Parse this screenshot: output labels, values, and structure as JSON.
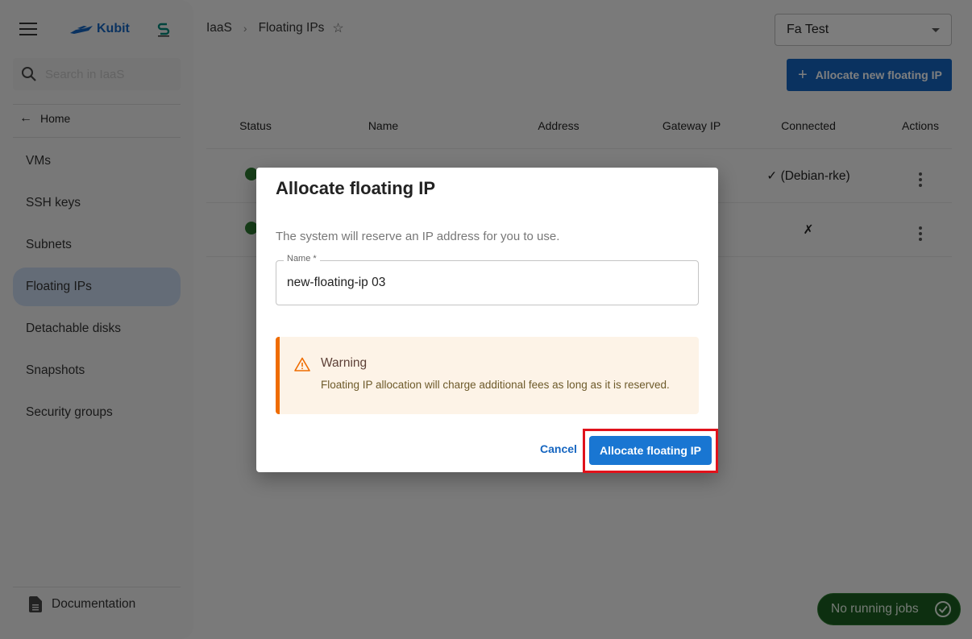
{
  "sidebar": {
    "logo_text": "Kubit",
    "search_placeholder": "Search in IaaS",
    "home_label": "Home",
    "items": [
      {
        "label": "VMs"
      },
      {
        "label": "SSH keys"
      },
      {
        "label": "Subnets"
      },
      {
        "label": "Floating IPs",
        "active": true
      },
      {
        "label": "Detachable disks"
      },
      {
        "label": "Snapshots"
      },
      {
        "label": "Security groups"
      }
    ],
    "documentation_label": "Documentation"
  },
  "header": {
    "breadcrumb": [
      "IaaS",
      "Floating IPs"
    ],
    "project_select": "Fa Test",
    "allocate_new_label": "Allocate new floating IP"
  },
  "table": {
    "columns": [
      "Status",
      "Name",
      "Address",
      "Gateway IP",
      "Connected",
      "Actions"
    ],
    "rows": [
      {
        "status": "active",
        "connected": "✓ (Debian-rke)"
      },
      {
        "status": "active",
        "connected": "✗"
      }
    ]
  },
  "dialog": {
    "title": "Allocate floating IP",
    "description": "The system will reserve an IP address for you to use.",
    "name_label": "Name *",
    "name_value": "new-floating-ip 03",
    "warning_title": "Warning",
    "warning_body": "Floating IP allocation will charge additional fees as long as it is reserved.",
    "cancel_label": "Cancel",
    "confirm_label": "Allocate floating IP"
  },
  "jobs": {
    "label": "No running jobs"
  },
  "colors": {
    "primary": "#1976d2",
    "warning": "#ef6c00",
    "success": "#2e7d32",
    "highlight": "#e0121b"
  }
}
